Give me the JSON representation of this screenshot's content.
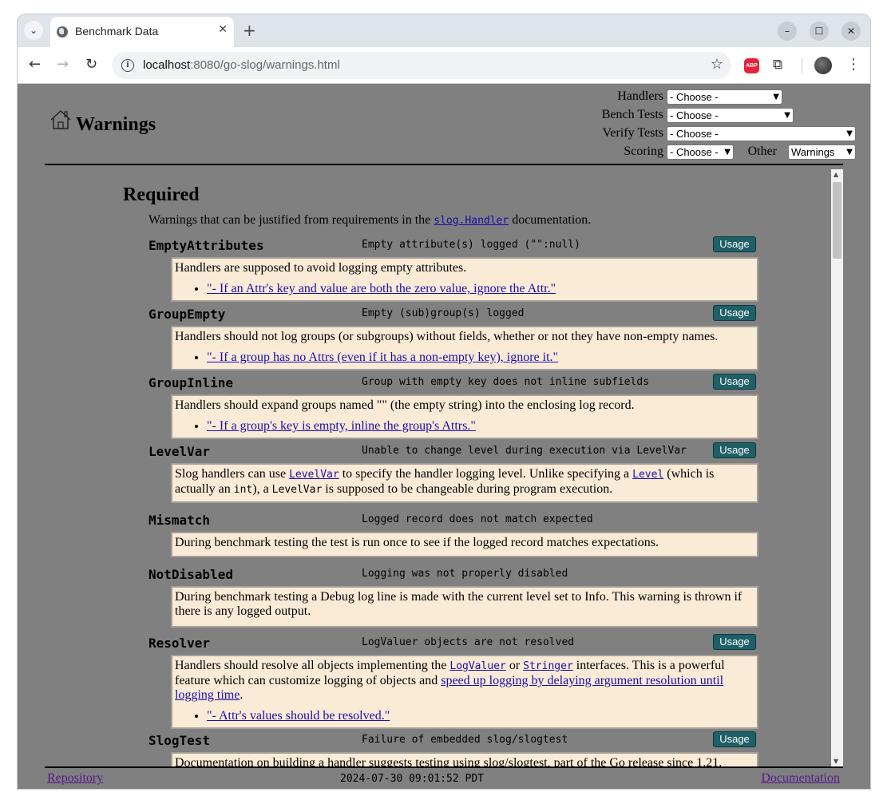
{
  "browser": {
    "tab_title": "Benchmark Data",
    "url_host": "localhost",
    "url_rest": ":8080/go-slog/warnings.html",
    "abp_label": "ABP"
  },
  "header": {
    "title": "Warnings",
    "controls": {
      "handlers_label": "Handlers",
      "handlers_value": "- Choose -",
      "bench_label": "Bench Tests",
      "bench_value": "- Choose -",
      "verify_label": "Verify Tests",
      "verify_value": "- Choose -",
      "scoring_label": "Scoring",
      "scoring_value": "- Choose -",
      "other_label": "Other",
      "other_value": "Warnings"
    }
  },
  "section": {
    "title": "Required",
    "desc_pre": "Warnings that can be justified from requirements in the ",
    "desc_link": "slog.Handler",
    "desc_post": " documentation."
  },
  "usage_label": "Usage",
  "warnings": [
    {
      "name": "EmptyAttributes",
      "summary": "Empty attribute(s) logged (\"\":null)",
      "text": "Handlers are supposed to avoid logging empty attributes.",
      "quote": "\"- If an Attr's key and value are both the zero value, ignore the Attr.\""
    },
    {
      "name": "GroupEmpty",
      "summary": "Empty (sub)group(s) logged",
      "text": "Handlers should not log groups (or subgroups) without fields, whether or not they have non-empty names.",
      "quote": "\"- If a group has no Attrs (even if it has a non-empty key), ignore it.\""
    },
    {
      "name": "GroupInline",
      "summary": "Group with empty key does not inline subfields",
      "text": "Handlers should expand groups named \"\" (the empty string) into the enclosing log record.",
      "quote": "\"- If a group's key is empty, inline the group's Attrs.\""
    },
    {
      "name": "LevelVar",
      "summary": "Unable to change level during execution via LevelVar",
      "t1": "Slog handlers can use ",
      "l1": "LevelVar",
      "t2": " to specify the handler logging level. Unlike specifying a ",
      "l2": "Level",
      "t3": " (which is actually an ",
      "c1": "int",
      "t4": "), a ",
      "c2": "LevelVar",
      "t5": " is supposed to be changeable during program execution."
    },
    {
      "name": "Mismatch",
      "summary": "Logged record does not match expected",
      "text": "During benchmark testing the test is run once to see if the logged record matches expectations."
    },
    {
      "name": "NotDisabled",
      "summary": "Logging was not properly disabled",
      "text": "During benchmark testing a Debug log line is made with the current level set to Info. This warning is thrown if there is any logged output."
    },
    {
      "name": "Resolver",
      "summary": "LogValuer objects are not resolved",
      "t1": "Handlers should resolve all objects implementing the ",
      "l1": "LogValuer",
      "t2": " or ",
      "l2": "Stringer",
      "t3": " interfaces. This is a powerful feature which can customize logging of objects and ",
      "l3": "speed up logging by delaying argument resolution until logging time",
      "t4": ".",
      "quote": "\"- Attr's values should be resolved.\""
    },
    {
      "name": "SlogTest",
      "summary": "Failure of embedded slog/slogtest",
      "text": "Documentation on building a handler suggests testing using slog/slogtest, part of the Go release since 1.21."
    }
  ],
  "footer": {
    "repo": "Repository",
    "timestamp": "2024-07-30 09:01:52 PDT",
    "docs": "Documentation"
  }
}
